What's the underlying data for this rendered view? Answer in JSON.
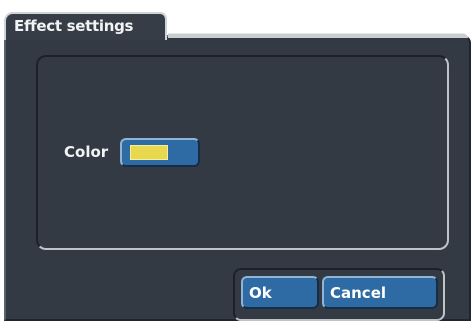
{
  "dialog": {
    "tab_label": "Effect settings"
  },
  "settings": {
    "color_label": "Color",
    "color_value": "#e8d84e"
  },
  "buttons": {
    "ok_label": "Ok",
    "cancel_label": "Cancel"
  },
  "colors": {
    "background": "#333a44",
    "button": "#2e6aa3",
    "text": "#f2f3f5"
  }
}
